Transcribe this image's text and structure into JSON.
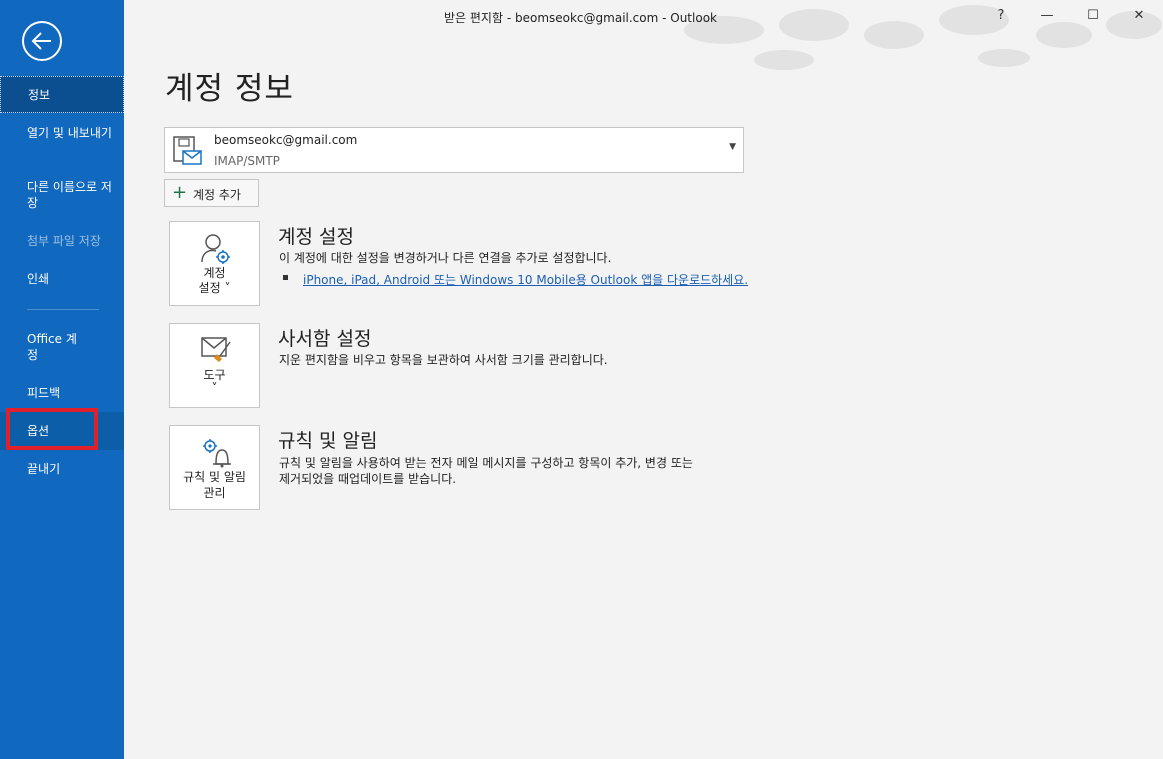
{
  "window": {
    "title": "받은 편지함 - beomseokc@gmail.com  -  Outlook",
    "help": "?",
    "minimize": "—",
    "maximize": "☐",
    "close": "✕"
  },
  "sidebar": {
    "items": [
      {
        "label": "정보"
      },
      {
        "label": "열기 및 내보내기"
      },
      {
        "label": "다른 이름으로 저장"
      },
      {
        "label": "첨부 파일 저장"
      },
      {
        "label": "인쇄"
      },
      {
        "label": "Office 계정"
      },
      {
        "label": "피드백"
      },
      {
        "label": "옵션"
      },
      {
        "label": "끝내기"
      }
    ]
  },
  "main": {
    "title": "계정 정보",
    "account": {
      "email": "beomseokc@gmail.com",
      "type": "IMAP/SMTP"
    },
    "add_account": "계정 추가",
    "sections": [
      {
        "tile_label_1": "계정",
        "tile_label_2": "설정 ˅",
        "title": "계정 설정",
        "desc": "이 계정에 대한 설정을 변경하거나 다른 연결을 추가로 설정합니다.",
        "link": "iPhone, iPad, Android 또는 Windows 10 Mobile용 Outlook 앱을 다운로드하세요."
      },
      {
        "tile_label_1": "도구",
        "tile_label_2": "˅",
        "title": "사서함 설정",
        "desc": "지운 편지함을 비우고 항목을 보관하여 사서함 크기를 관리합니다."
      },
      {
        "tile_label_1": "규칙 및 알림",
        "tile_label_2": "관리",
        "title": "규칙 및 알림",
        "desc_1": "규칙 및 알림을 사용하여 받는 전자 메일 메시지를 구성하고 항목이 추가, 변경 또는",
        "desc_2": "제거되었을 때업데이트를 받습니다."
      }
    ]
  },
  "colors": {
    "sidebar": "#1068bf",
    "sidebar_active": "#0b4f90",
    "highlight": "#e0202a",
    "link": "#1a5fb4"
  }
}
